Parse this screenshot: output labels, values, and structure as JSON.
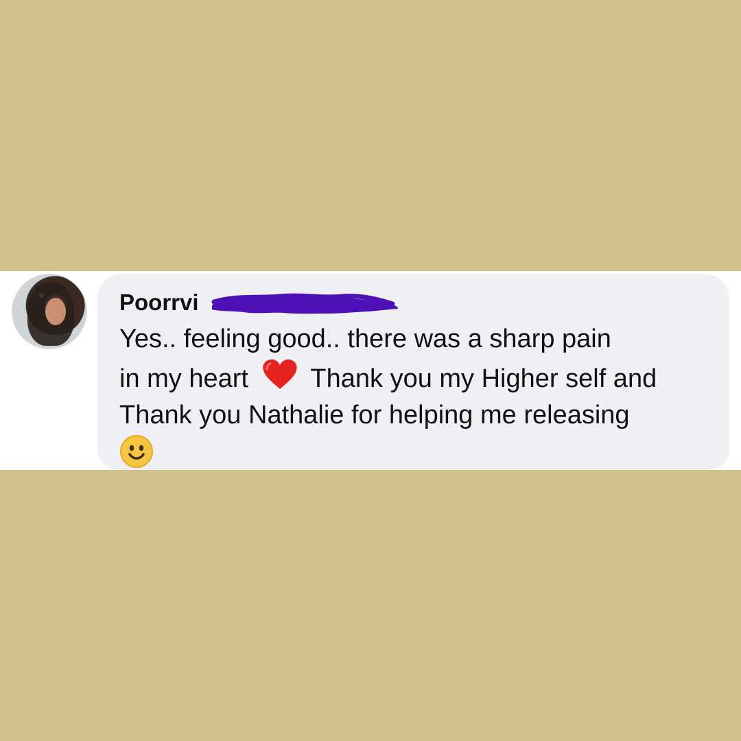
{
  "comment": {
    "author": "Poorrvi",
    "message_lines": [
      "Yes.. feeling good..  there was a sharp pain",
      "in my heart",
      "Thank you my Higher self and",
      "Thank you Nathalie for helping me releasing"
    ],
    "emojis": {
      "heart": "red-heart-icon",
      "smile": "smiling-face-icon"
    }
  },
  "colors": {
    "background": "#d1c28c",
    "strip": "#ffffff",
    "bubble": "#eff0f4",
    "text": "#111111",
    "redaction": "#4f10b7",
    "heart": "#e52421",
    "smile": "#f6c63e"
  }
}
